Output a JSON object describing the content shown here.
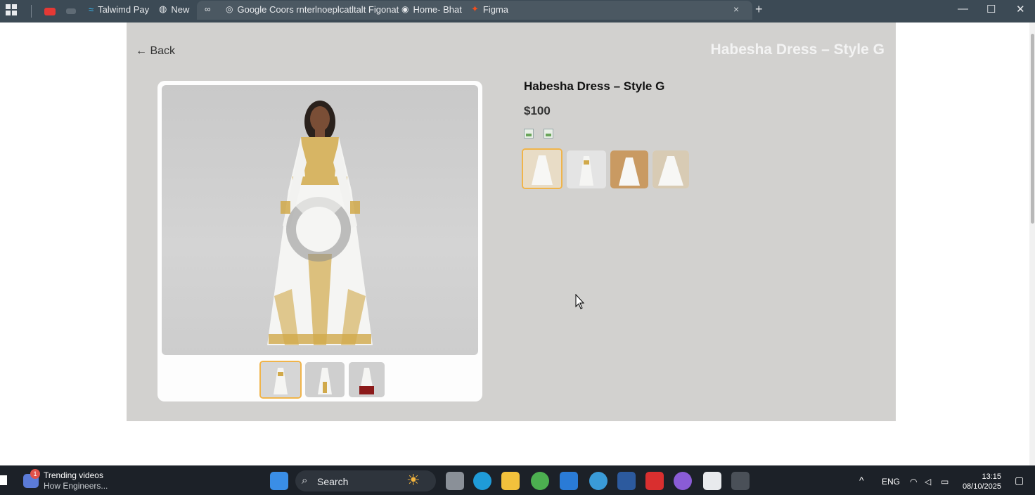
{
  "browser": {
    "bookmarks": [
      {
        "label": "",
        "icon": "youtube-icon",
        "color": "#e53935"
      },
      {
        "label": "",
        "icon": "site-icon",
        "color": "#5f6b75"
      },
      {
        "label": "Talwimd Pay",
        "icon": "tailwind-icon",
        "color": "#38bdf8"
      },
      {
        "label": "New",
        "icon": "globe-icon",
        "color": "#9aa4ad"
      },
      {
        "label": "",
        "icon": "link-icon",
        "color": "#9aa4ad"
      },
      {
        "label": "Google Coors  rnterlnoeplcatltalt Figonat",
        "icon": "google-icon",
        "color": "#9aa4ad"
      },
      {
        "label": "Home- Bhat",
        "icon": "chat-icon",
        "color": "#9aa4ad"
      },
      {
        "label": "Figma",
        "icon": "figma-icon",
        "color": "#f24e1e"
      }
    ],
    "close_tab": "×",
    "new_tab": "+",
    "window_controls": {
      "minimize": "—",
      "maximize": "☐",
      "close": "✕"
    }
  },
  "page": {
    "back_label": "← Back",
    "header_title": "Habesha Dress – Style G",
    "product": {
      "title": "Habesha Dress – Style G",
      "price": "$100"
    },
    "gallery_thumbnails": [
      {
        "alt": "dress-front",
        "selected": true
      },
      {
        "alt": "dress-side",
        "selected": false
      },
      {
        "alt": "dress-red",
        "selected": false
      }
    ],
    "variant_thumbnails": [
      {
        "alt": "variant-1",
        "selected": true
      },
      {
        "alt": "variant-2",
        "selected": false
      },
      {
        "alt": "variant-3",
        "selected": false
      },
      {
        "alt": "variant-4",
        "selected": false
      }
    ]
  },
  "taskbar": {
    "news_title": "Trending videos",
    "news_subtitle": "How Engineers...",
    "news_badge": "1",
    "search_label": "Search",
    "language": "ENG",
    "time": "13:15",
    "date": "08/10/2025"
  }
}
